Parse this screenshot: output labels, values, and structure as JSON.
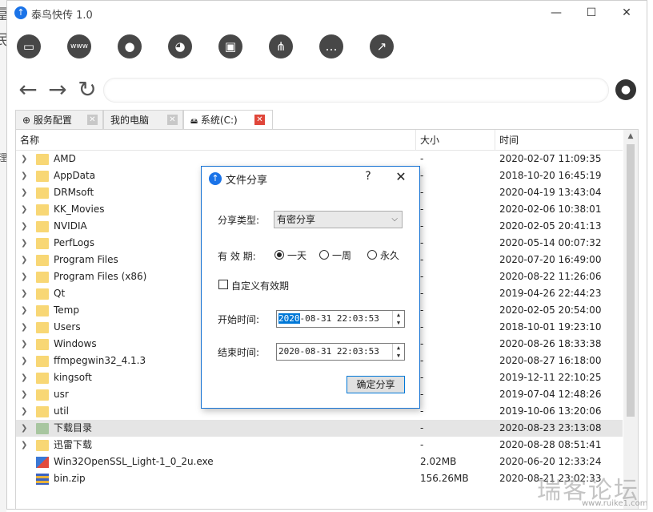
{
  "window": {
    "title": "泰鸟快传  1.0",
    "controls": {
      "minimize": "—",
      "maximize": "☐",
      "close": "✕"
    }
  },
  "edge_glyphs": [
    "冨",
    "民",
    "理"
  ],
  "toolbar": [
    {
      "name": "monitor-icon",
      "glyph": "▭"
    },
    {
      "name": "www-icon",
      "glyph": "www"
    },
    {
      "name": "user-icon",
      "glyph": "●"
    },
    {
      "name": "palette-icon",
      "glyph": "◕"
    },
    {
      "name": "window-icon",
      "glyph": "▣"
    },
    {
      "name": "share-icon",
      "glyph": "⋔"
    },
    {
      "name": "chat-icon",
      "glyph": "…"
    },
    {
      "name": "trend-icon",
      "glyph": "↗"
    }
  ],
  "nav": {
    "back": "←",
    "forward": "→",
    "refresh": "↻",
    "address_value": "",
    "user_glyph": "●"
  },
  "tabs": [
    {
      "label": "服务配置",
      "icon": "⊕",
      "close": "✕",
      "active": false
    },
    {
      "label": "我的电脑",
      "icon": "",
      "close": "✕",
      "active": false
    },
    {
      "label": "系统(C:)",
      "icon": "🖴",
      "close": "✕",
      "active": true
    }
  ],
  "table": {
    "columns": [
      "名称",
      "大小",
      "时间"
    ],
    "rows": [
      {
        "name": "AMD",
        "size": "-",
        "time": "2020-02-07 11:09:35",
        "type": "folder"
      },
      {
        "name": "AppData",
        "size": "-",
        "time": "2018-10-20 16:45:19",
        "type": "folder"
      },
      {
        "name": "DRMsoft",
        "size": "-",
        "time": "2020-04-19 13:43:04",
        "type": "folder"
      },
      {
        "name": "KK_Movies",
        "size": "-",
        "time": "2020-02-06 10:38:01",
        "type": "folder"
      },
      {
        "name": "NVIDIA",
        "size": "-",
        "time": "2020-02-05 20:41:13",
        "type": "folder"
      },
      {
        "name": "PerfLogs",
        "size": "-",
        "time": "2020-05-14 00:07:32",
        "type": "folder"
      },
      {
        "name": "Program Files",
        "size": "-",
        "time": "2020-07-20 16:49:00",
        "type": "folder"
      },
      {
        "name": "Program Files (x86)",
        "size": "-",
        "time": "2020-08-22 11:26:06",
        "type": "folder"
      },
      {
        "name": "Qt",
        "size": "-",
        "time": "2019-04-26 22:44:23",
        "type": "folder"
      },
      {
        "name": "Temp",
        "size": "-",
        "time": "2020-02-05 20:54:00",
        "type": "folder"
      },
      {
        "name": "Users",
        "size": "-",
        "time": "2018-10-01 19:23:10",
        "type": "folder"
      },
      {
        "name": "Windows",
        "size": "-",
        "time": "2020-08-26 18:33:38",
        "type": "folder"
      },
      {
        "name": "ffmpegwin32_4.1.3",
        "size": "-",
        "time": "2020-08-27 16:18:00",
        "type": "folder"
      },
      {
        "name": "kingsoft",
        "size": "-",
        "time": "2019-12-11 22:10:25",
        "type": "folder"
      },
      {
        "name": "usr",
        "size": "-",
        "time": "2019-07-04 12:48:26",
        "type": "folder"
      },
      {
        "name": "util",
        "size": "-",
        "time": "2019-10-06 13:20:06",
        "type": "folder"
      },
      {
        "name": "下载目录",
        "size": "-",
        "time": "2020-08-23 23:13:08",
        "type": "folder-green",
        "selected": true
      },
      {
        "name": "迅雷下载",
        "size": "-",
        "time": "2020-08-28 08:51:41",
        "type": "folder"
      },
      {
        "name": "Win32OpenSSL_Light-1_0_2u.exe",
        "size": "2.02MB",
        "time": "2020-06-20 12:33:24",
        "type": "exe"
      },
      {
        "name": "bin.zip",
        "size": "156.26MB",
        "time": "2020-08-21 23:02:33",
        "type": "zip"
      }
    ]
  },
  "dialog": {
    "title": "文件分享",
    "help": "?",
    "close": "✕",
    "share_type_label": "分享类型:",
    "share_type_value": "有密分享",
    "validity_label": "有 效 期:",
    "options": [
      {
        "label": "一天",
        "selected": true
      },
      {
        "label": "一周",
        "selected": false
      },
      {
        "label": "永久",
        "selected": false
      }
    ],
    "custom_label": "自定义有效期",
    "custom_checked": false,
    "start_label": "开始时间:",
    "start_year": "2020",
    "start_rest": "-08-31 22:03:53",
    "end_label": "结束时间:",
    "end_value": "2020-08-31 22:03:53",
    "confirm_label": "确定分享"
  },
  "watermark": {
    "text": "瑞客论坛",
    "url": "www.ruike1.com"
  }
}
